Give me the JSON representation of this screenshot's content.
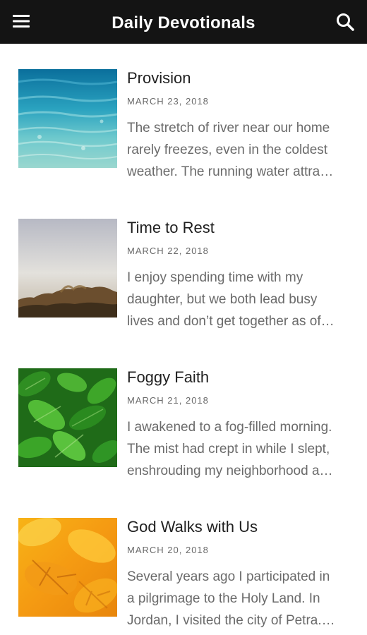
{
  "header": {
    "title": "Daily Devotionals",
    "left_icon": "menu-icon",
    "right_icon": "search-icon",
    "background": "#141414"
  },
  "devotionals": [
    {
      "title": "Provision",
      "date": "MARCH 23, 2018",
      "excerpt_lines": [
        "The stretch of river near our home",
        "rarely freezes, even in the coldest",
        "weather.  The running water attra…"
      ],
      "thumbnail": "river-water"
    },
    {
      "title": "Time to Rest",
      "date": "MARCH 22, 2018",
      "excerpt_lines": [
        "I enjoy spending time with my",
        "daughter, but we both lead busy",
        "lives and don’t get together as of…"
      ],
      "thumbnail": "misty-hillside"
    },
    {
      "title": "Foggy Faith",
      "date": "MARCH 21, 2018",
      "excerpt_lines": [
        "I awakened to a fog-filled morning.",
        "The mist had crept in while I slept,",
        "enshrouding my neighborhood a…"
      ],
      "thumbnail": "green-leaves"
    },
    {
      "title": "God Walks with Us",
      "date": "MARCH 20, 2018",
      "excerpt_lines": [
        "Several years ago I participated in",
        "a pilgrimage to the Holy Land.  In",
        "Jordan, I visited the city of Petra.…"
      ],
      "thumbnail": "autumn-leaves"
    }
  ]
}
